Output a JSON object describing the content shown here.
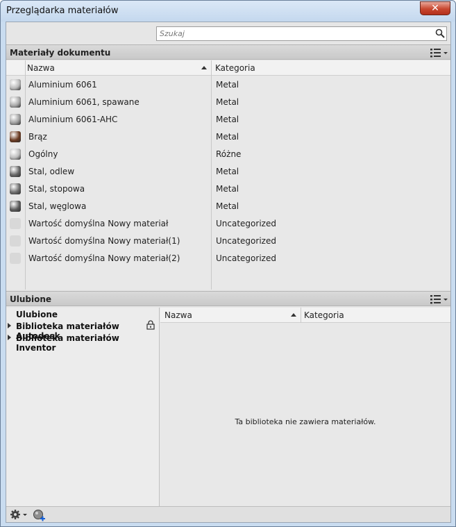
{
  "window": {
    "title": "Przeglądarka materiałów",
    "close_label": "✕"
  },
  "search": {
    "placeholder": "Szukaj"
  },
  "document_materials": {
    "title": "Materiały dokumentu",
    "col_name": "Nazwa",
    "col_category": "Kategoria",
    "rows": [
      {
        "name": "Aluminium 6061",
        "category": "Metal",
        "swatch": "#b9b9b9"
      },
      {
        "name": "Aluminium 6061, spawane",
        "category": "Metal",
        "swatch": "#a9a9a9"
      },
      {
        "name": "Aluminium 6061-AHC",
        "category": "Metal",
        "swatch": "#9f9f9f"
      },
      {
        "name": "Brąz",
        "category": "Metal",
        "swatch": "#6b3b22"
      },
      {
        "name": "Ogólny",
        "category": "Różne",
        "swatch": "#bdbdbd"
      },
      {
        "name": "Stal, odlew",
        "category": "Metal",
        "swatch": "#666666"
      },
      {
        "name": "Stal, stopowa",
        "category": "Metal",
        "swatch": "#6e6e6e"
      },
      {
        "name": "Stal, węglowa",
        "category": "Metal",
        "swatch": "#5c5c5c"
      },
      {
        "name": "Wartość domyślna Nowy materiał",
        "category": "Uncategorized",
        "swatch": "#d8d8d8"
      },
      {
        "name": "Wartość domyślna Nowy materiał(1)",
        "category": "Uncategorized",
        "swatch": "#d8d8d8"
      },
      {
        "name": "Wartość domyślna Nowy materiał(2)",
        "category": "Uncategorized",
        "swatch": "#d8d8d8"
      }
    ]
  },
  "favorites": {
    "title": "Ulubione",
    "tree": [
      {
        "label": "Ulubione",
        "expandable": false
      },
      {
        "label": "Biblioteka materiałów Autodesk",
        "expandable": true,
        "locked": true
      },
      {
        "label": "Biblioteka materiałów Inventor",
        "expandable": true
      }
    ],
    "col_name": "Nazwa",
    "col_category": "Kategoria",
    "empty_message": "Ta biblioteka nie zawiera materiałów."
  },
  "icons": {
    "search": "search-icon",
    "list_view": "list-view-icon",
    "gear": "gear-icon",
    "add_material": "add-material-icon",
    "lock": "lock-icon"
  }
}
